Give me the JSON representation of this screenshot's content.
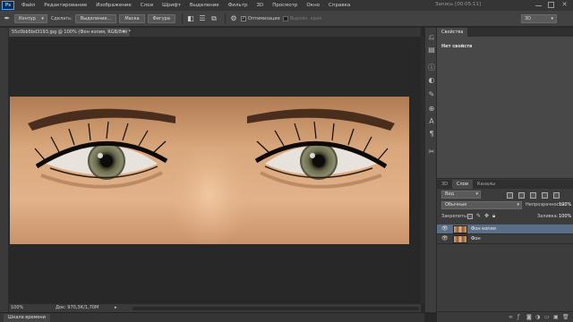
{
  "menu": {
    "logo": "Ps",
    "items": [
      "Файл",
      "Редактирование",
      "Изображение",
      "Слои",
      "Шрифт",
      "Выделение",
      "Фильтр",
      "3D",
      "Просмотр",
      "Окно",
      "Справка"
    ]
  },
  "window_title": "Запись [00:05:11]",
  "options": {
    "mode": "Контур",
    "make_label": "Сделать:",
    "selection_btn": "Выделение...",
    "mask_btn": "Маска",
    "shape_btn": "Фигура",
    "optimize_label": "Оптимизация",
    "align_edges_label": "Выровн. края",
    "workspace": "3D"
  },
  "document": {
    "tab_title": "55c0bb5bd3193.jpg @ 100% (Фон копия, RGB/8#) *",
    "zoom": "100%",
    "info": "Док: 970,3К/1,70М"
  },
  "bottom_tab": "Шкала времени",
  "properties": {
    "tab": "Свойства",
    "empty_text": "Нет свойств"
  },
  "layers": {
    "tabs": [
      "3D",
      "Слои",
      "Каналы"
    ],
    "filter": "Вид",
    "blend_mode": "Обычные",
    "opacity_label": "Непрозрачность:",
    "opacity": "100%",
    "lock_label": "Закрепить:",
    "fill_label": "Заливка:",
    "fill": "100%",
    "items": [
      {
        "name": "Фон копия",
        "selected": true
      },
      {
        "name": "Фон",
        "selected": false
      }
    ]
  }
}
